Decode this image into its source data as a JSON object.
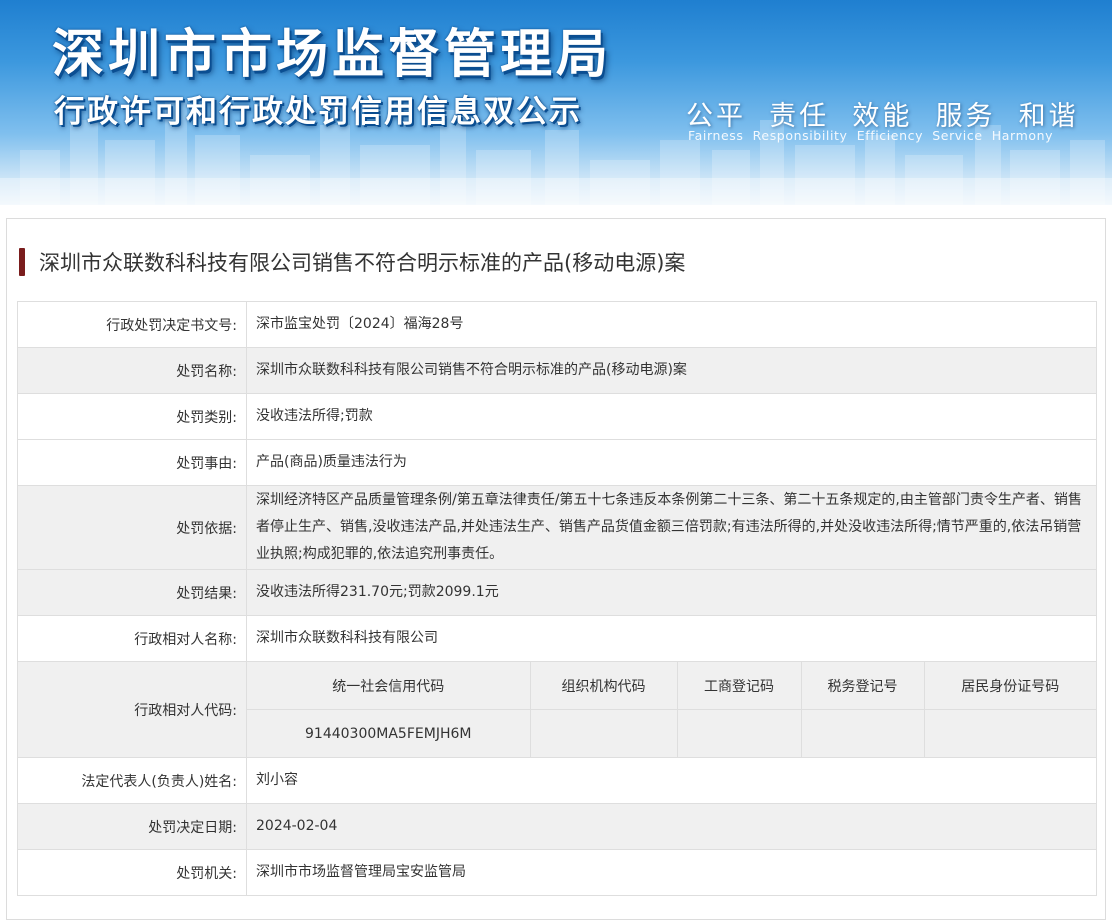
{
  "banner": {
    "title": "深圳市市场监督管理局",
    "subtitle": "行政许可和行政处罚信用信息双公示",
    "slogan": "公平  责任  效能  服务  和谐",
    "slogan_en": "Fairness  Responsibility  Efficiency  Service  Harmony"
  },
  "case": {
    "title": "深圳市众联数科科技有限公司销售不符合明示标准的产品(移动电源)案"
  },
  "rows": {
    "doc_no": {
      "label": "行政处罚决定书文号:",
      "value": "深市监宝处罚〔2024〕福海28号"
    },
    "name": {
      "label": "处罚名称:",
      "value": "深圳市众联数科科技有限公司销售不符合明示标准的产品(移动电源)案"
    },
    "category": {
      "label": "处罚类别:",
      "value": "没收违法所得;罚款"
    },
    "reason": {
      "label": "处罚事由:",
      "value": "产品(商品)质量违法行为"
    },
    "basis": {
      "label": "处罚依据:",
      "value": "深圳经济特区产品质量管理条例/第五章法律责任/第五十七条违反本条例第二十三条、第二十五条规定的,由主管部门责令生产者、销售者停止生产、销售,没收违法产品,并处违法生产、销售产品货值金额三倍罚款;有违法所得的,并处没收违法所得;情节严重的,依法吊销营业执照;构成犯罪的,依法追究刑事责任。"
    },
    "result": {
      "label": "处罚结果:",
      "value": "没收违法所得231.70元;罚款2099.1元"
    },
    "party_name": {
      "label": "行政相对人名称:",
      "value": "深圳市众联数科科技有限公司"
    },
    "party_code": {
      "label": "行政相对人代码:",
      "headers": [
        "统一社会信用代码",
        "组织机构代码",
        "工商登记码",
        "税务登记号",
        "居民身份证号码"
      ],
      "values": [
        "91440300MA5FEMJH6M",
        "",
        "",
        "",
        ""
      ]
    },
    "legal_rep": {
      "label": "法定代表人(负责人)姓名:",
      "value": "刘小容"
    },
    "date": {
      "label": "处罚决定日期:",
      "value": "2024-02-04"
    },
    "authority": {
      "label": "处罚机关:",
      "value": "深圳市市场监督管理局宝安监管局"
    }
  }
}
